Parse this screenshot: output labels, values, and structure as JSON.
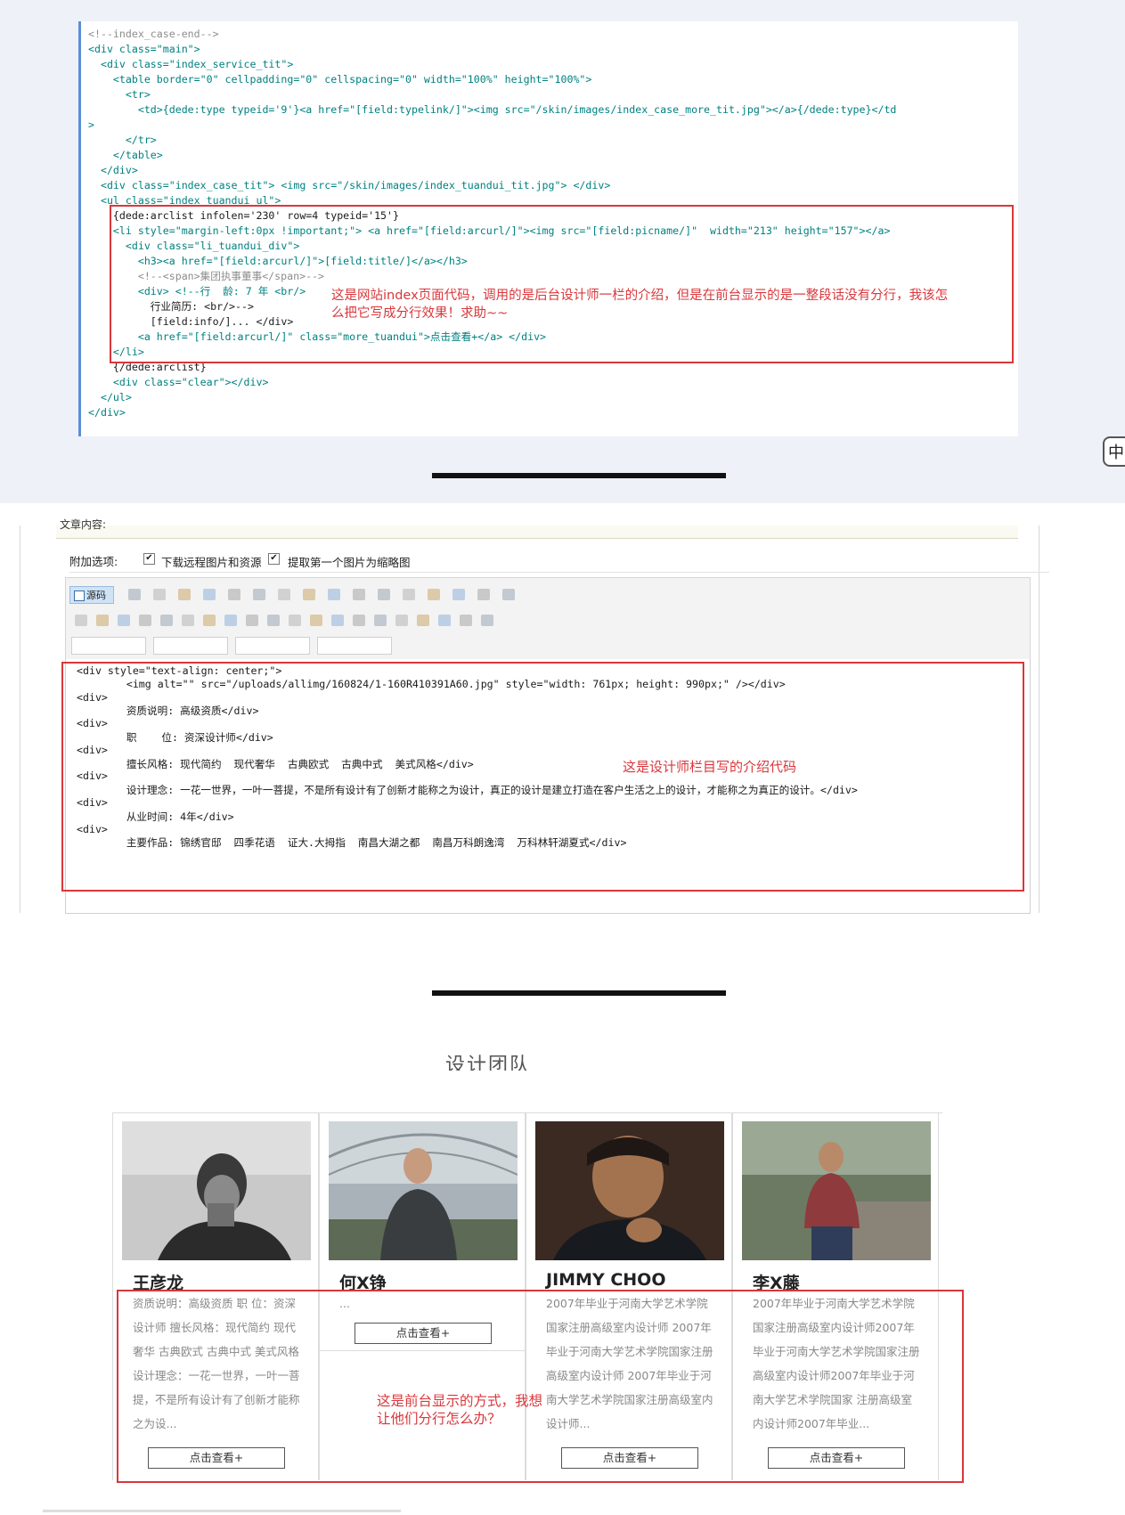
{
  "code_screen": {
    "lines": [
      "<!--index_case-end-->",
      "<div class=\"main\">",
      "  <div class=\"index_service_tit\">",
      "    <table border=\"0\" cellpadding=\"0\" cellspacing=\"0\" width=\"100%\" height=\"100%\">",
      "      <tr>",
      "        <td>{dede:type typeid='9'}<a href=\"[field:typelink/]\"><img src=\"/skin/images/index_case_more_tit.jpg\"></a>{/dede:type}</td",
      ">",
      "      </tr>",
      "    </table>",
      "  </div>",
      "  <div class=\"index_case_tit\"> <img src=\"/skin/images/index_tuandui_tit.jpg\"> </div>",
      "  <ul class=\"index_tuandui_ul\">",
      "    {dede:arclist infolen='230' row=4 typeid='15'}",
      "    <li style=\"margin-left:0px !important;\"> <a href=\"[field:arcurl/]\"><img src=\"[field:picname/]\"  width=\"213\" height=\"157\"></a>",
      "      <div class=\"li_tuandui_div\">",
      "        <h3><a href=\"[field:arcurl/]\">[field:title/]</a></h3>",
      "        <!--<span>集团执事董事</span>-->",
      "        <div> <!--行  龄: 7 年 <br/>",
      "          行业简历: <br/>-->",
      "          [field:info/]... </div>",
      "        <a href=\"[field:arcurl/]\" class=\"more_tuandui\">点击查看+</a> </div>",
      "    </li>",
      "    {/dede:arclist}",
      "    <div class=\"clear\"></div>",
      "  </ul>",
      "</div>"
    ],
    "annotation": "这是网站index页面代码，调用的是后台设计师一栏的介绍，但是在前台显示的是一整段话没有分行，我该怎么把它写成分行效果！求助~~",
    "ime_indicator": "中"
  },
  "editor_screen": {
    "top_label": "文章内容:",
    "options_label": "附加选项:",
    "option_download": "下载远程图片和资源",
    "option_thumbnail": "提取第一个图片为缩略图",
    "source_button": "源码",
    "toolbar_icons": [
      "cut-icon",
      "copy-icon",
      "paste-icon",
      "paste-text-icon",
      "paste-word-icon",
      "print-icon",
      "undo-icon",
      "redo-icon",
      "find-icon",
      "replace-icon",
      "select-all-icon",
      "remove-format-icon",
      "template-icon",
      "image-icon",
      "flash-icon",
      "maximize-icon",
      "bold-icon",
      "italic-icon",
      "underline-icon",
      "strike-icon",
      "ordered-list-icon",
      "unordered-list-icon",
      "outdent-icon",
      "indent-icon",
      "blockquote-icon",
      "align-left-icon",
      "align-center-icon",
      "align-right-icon",
      "justify-icon",
      "table-icon",
      "hr-icon",
      "smiley-icon",
      "special-char-icon",
      "link-icon",
      "unlink-icon",
      "anchor-icon",
      "text-color-icon",
      "bg-color-icon"
    ],
    "code_lines": [
      "<div style=\"text-align: center;\">",
      "        <img alt=\"\" src=\"/uploads/allimg/160824/1-160R410391A60.jpg\" style=\"width: 761px; height: 990px;\" /></div>",
      "<div>",
      "        资质说明: 高级资质</div>",
      "<div>",
      "        职    位: 资深设计师</div>",
      "<div>",
      "        擅长风格: 现代简约  现代奢华  古典欧式  古典中式  美式风格</div>",
      "<div>",
      "        设计理念: 一花一世界，一叶一菩提，不是所有设计有了创新才能称之为设计，真正的设计是建立打造在客户生活之上的设计，才能称之为真正的设计。</div>",
      "<div>",
      "        从业时间: 4年</div>",
      "<div>",
      "        主要作品: 锦绣官邸  四季花语  证大.大拇指  南昌大湖之都  南昌万科朗逸湾  万科林轩湖夏式</div>"
    ],
    "annotation": "这是设计师栏目写的介绍代码"
  },
  "frontend_screen": {
    "section_title_partial": "设计团队",
    "more_label": "点击查看+",
    "annotation": "这是前台显示的方式，我想让他们分行怎么办？",
    "designers": [
      {
        "name": "王彦龙",
        "info": "资质说明：高级资质 职 位：资深设计师 擅长风格：现代简约 现代奢华 古典欧式 古典中式 美式风格 设计理念：一花一世界，一叶一菩提，不是所有设计有了创新才能称之为设..."
      },
      {
        "name": "何X铮",
        "info": "..."
      },
      {
        "name": "JIMMY CHOO",
        "info": "2007年毕业于河南大学艺术学院国家注册高级室内设计师 2007年毕业于河南大学艺术学院国家注册高级室内设计师 2007年毕业于河南大学艺术学院国家注册高级室内设计师..."
      },
      {
        "name": "李X藤",
        "info": "2007年毕业于河南大学艺术学院国家注册高级室内设计师2007年毕业于河南大学艺术学院国家注册高级室内设计师2007年毕业于河南大学艺术学院国家 注册高级室内设计师2007年毕业..."
      }
    ]
  },
  "colors": {
    "annotation_red": "#d9373b",
    "code_tag": "#008080",
    "code_comment": "#8d8d8d",
    "section_bg": "#eef1f7"
  }
}
